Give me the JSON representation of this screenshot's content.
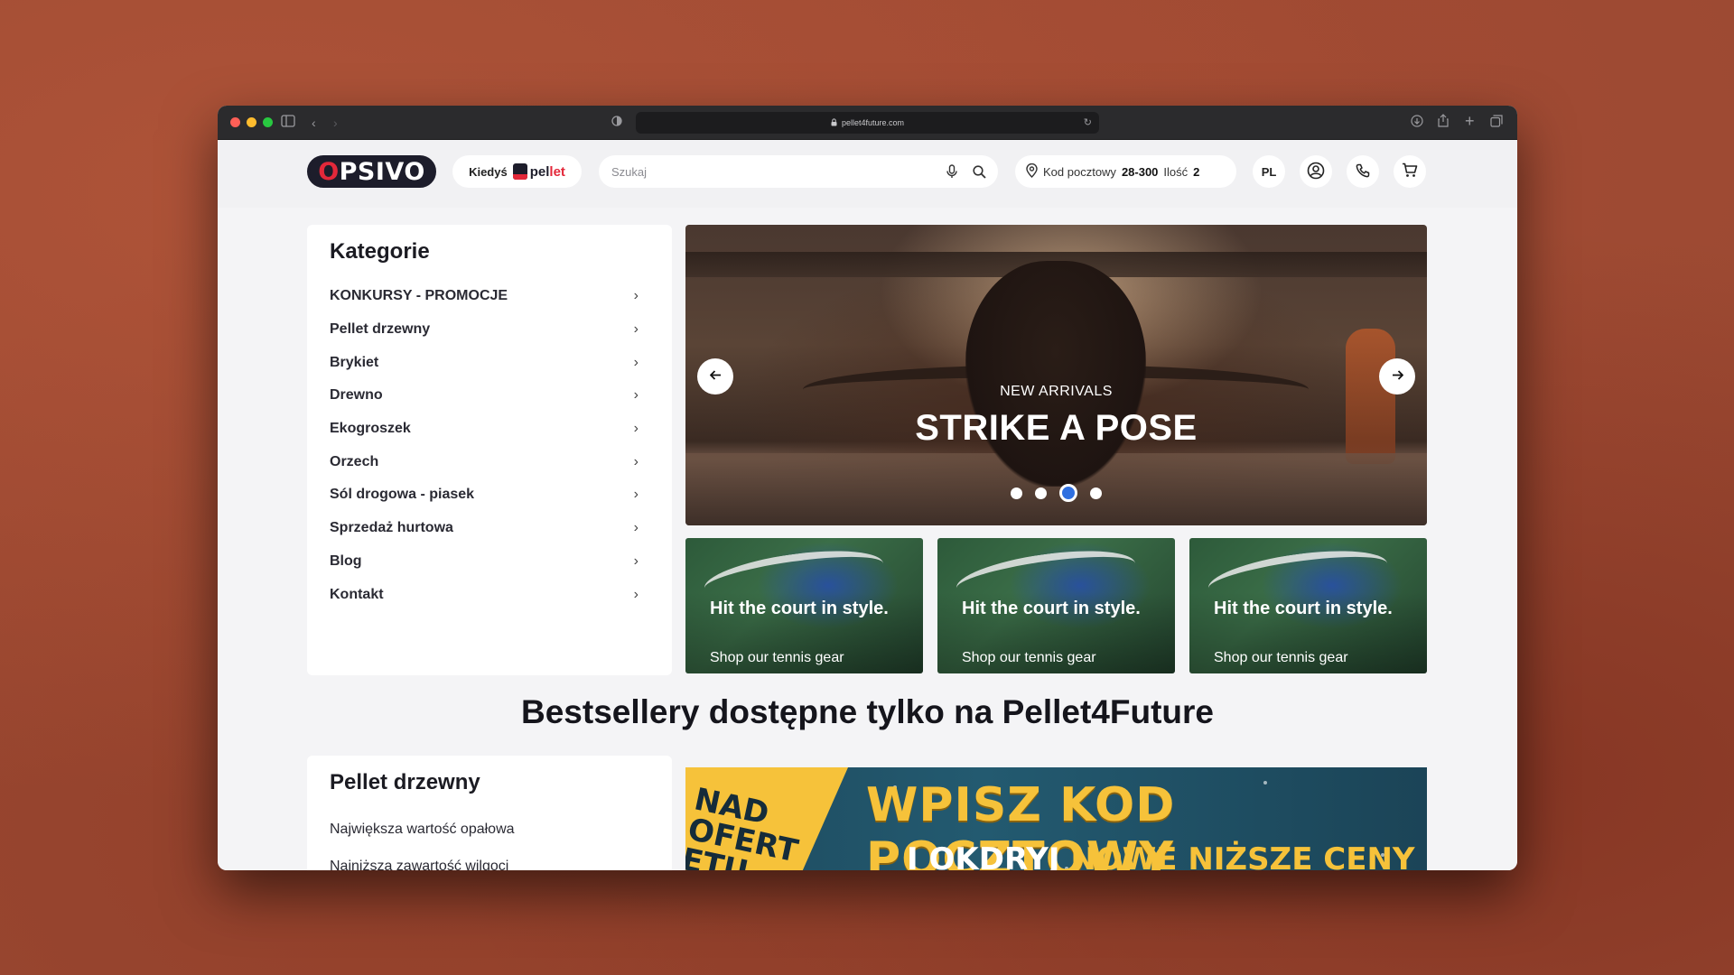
{
  "browser": {
    "url": "pellet4future.com"
  },
  "header": {
    "logo_text_prefix": "O",
    "logo_text_rest": "PSIVO",
    "kiedys_label": "Kiedyś",
    "pellet_logo_a": "pel",
    "pellet_logo_b": "let",
    "search_placeholder": "Szukaj",
    "postal_label": "Kod pocztowy",
    "postal_code": "28-300",
    "quantity_label": "Ilość",
    "quantity_value": "2",
    "language": "PL"
  },
  "categories": {
    "title": "Kategorie",
    "items": [
      {
        "label": "KONKURSY - PROMOCJE"
      },
      {
        "label": "Pellet drzewny"
      },
      {
        "label": "Brykiet"
      },
      {
        "label": "Drewno"
      },
      {
        "label": "Ekogroszek"
      },
      {
        "label": "Orzech"
      },
      {
        "label": "Sól drogowa - piasek"
      },
      {
        "label": "Sprzedaż hurtowa"
      },
      {
        "label": "Blog"
      },
      {
        "label": "Kontakt"
      }
    ]
  },
  "hero": {
    "subtitle": "NEW ARRIVALS",
    "title": "STRIKE A POSE",
    "slide_count": 4,
    "active_slide": 3
  },
  "promos": [
    {
      "title": "Hit the court in style.",
      "subtitle": "Shop our tennis gear"
    },
    {
      "title": "Hit the court in style.",
      "subtitle": "Shop our tennis gear"
    },
    {
      "title": "Hit the court in style.",
      "subtitle": "Shop our tennis gear"
    }
  ],
  "bestsellers": {
    "heading": "Bestsellery dostępne tylko na Pellet4Future"
  },
  "pellet_section": {
    "title": "Pellet drzewny",
    "items": [
      {
        "label": "Największa wartość opałowa"
      },
      {
        "label": "Najniższa zawartość wilgoci"
      }
    ]
  },
  "banner": {
    "side_text_1": "NAD",
    "side_text_2": "OFERT",
    "side_text_3": "ETU",
    "main_text": "WPISZ KOD POCZTOWY",
    "second_text_a": "I OKDRYJ ",
    "second_text_b": "NOWE NIŻSZE CENY"
  },
  "colors": {
    "accent_blue": "#2f6fe0",
    "brand_red": "#e3283a",
    "brand_dark": "#1d1d2b",
    "banner_yellow": "#f6c23a"
  }
}
